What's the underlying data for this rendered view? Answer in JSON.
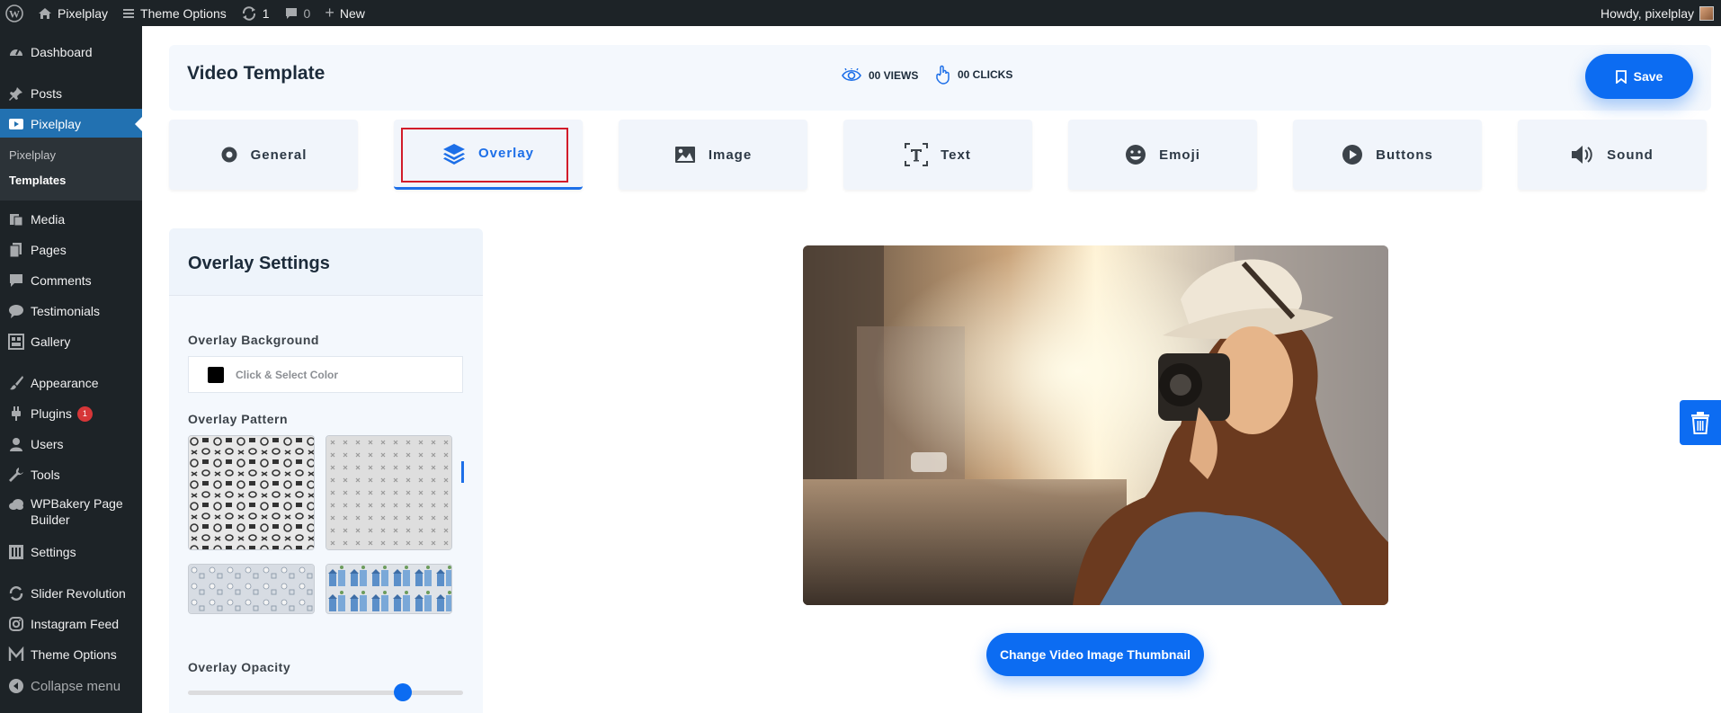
{
  "adminbar": {
    "site_name": "Pixelplay",
    "theme_options": "Theme Options",
    "updates_count": "1",
    "comments_count": "0",
    "new_label": "New",
    "howdy": "Howdy, pixelplay"
  },
  "sidebar": {
    "dashboard": "Dashboard",
    "posts": "Posts",
    "pixelplay": "Pixelplay",
    "sub_pixelplay": "Pixelplay",
    "sub_templates": "Templates",
    "media": "Media",
    "pages": "Pages",
    "comments": "Comments",
    "testimonials": "Testimonials",
    "gallery": "Gallery",
    "appearance": "Appearance",
    "plugins": "Plugins",
    "plugins_badge": "1",
    "users": "Users",
    "tools": "Tools",
    "wpbakery_line1": "WPBakery Page",
    "wpbakery_line2": "Builder",
    "settings": "Settings",
    "slider_revolution": "Slider Revolution",
    "instagram_feed": "Instagram Feed",
    "theme_options": "Theme Options",
    "collapse": "Collapse menu"
  },
  "header": {
    "title": "Video Template",
    "views": "00 VIEWS",
    "clicks": "00 CLICKS",
    "save": "Save"
  },
  "tabs": {
    "general": "General",
    "overlay": "Overlay",
    "image": "Image",
    "text": "Text",
    "emoji": "Emoji",
    "buttons": "Buttons",
    "sound": "Sound"
  },
  "panel": {
    "title": "Overlay Settings",
    "background_label": "Overlay Background",
    "color_placeholder": "Click & Select Color",
    "pattern_label": "Overlay Pattern",
    "opacity_label": "Overlay Opacity",
    "opacity_value": 0.78
  },
  "preview": {
    "change_button": "Change Video Image Thumbnail"
  },
  "colors": {
    "accent": "#0c6cf2",
    "wp_dark": "#1d2327",
    "wp_active": "#2271b1",
    "highlight_border": "#d21c2a"
  }
}
